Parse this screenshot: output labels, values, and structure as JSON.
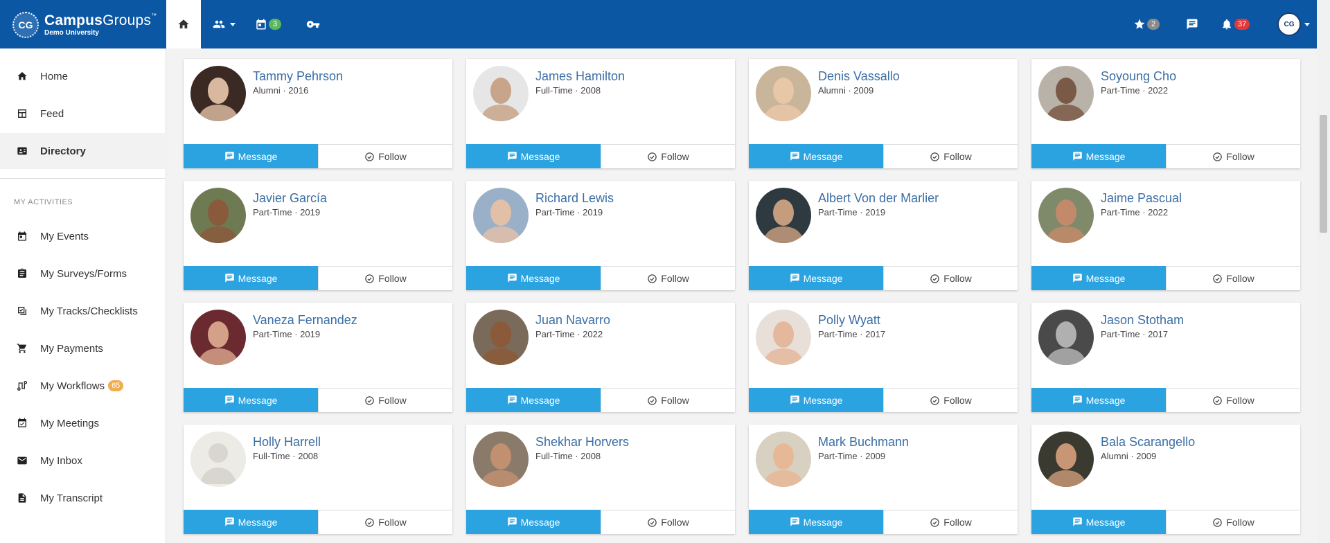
{
  "header": {
    "brand_main": "Campus",
    "brand_light": "Groups",
    "brand_tm": "™",
    "brand_sub": "Demo University",
    "logo_initials": "CG",
    "events_badge": "3",
    "favorites_badge": "2",
    "notifications_badge": "37",
    "colors": {
      "bar": "#0b57a4",
      "green": "#5cb85c",
      "red": "#e2393b"
    }
  },
  "sidebar": {
    "home": "Home",
    "feed": "Feed",
    "directory": "Directory",
    "heading": "MY ACTIVITIES",
    "my_events": "My Events",
    "my_surveys": "My Surveys/Forms",
    "my_tracks": "My Tracks/Checklists",
    "my_payments": "My Payments",
    "my_workflows": "My Workflows",
    "workflows_badge": "65",
    "my_meetings": "My Meetings",
    "my_inbox": "My Inbox",
    "my_transcript": "My Transcript"
  },
  "buttons": {
    "message": "Message",
    "follow": "Follow"
  },
  "people": [
    {
      "name": "Tammy Pehrson",
      "meta": "Alumni · 2016"
    },
    {
      "name": "James Hamilton",
      "meta": "Full-Time · 2008"
    },
    {
      "name": "Denis Vassallo",
      "meta": "Alumni · 2009"
    },
    {
      "name": "Soyoung Cho",
      "meta": "Part-Time · 2022"
    },
    {
      "name": "Javier García",
      "meta": "Part-Time · 2019"
    },
    {
      "name": "Richard Lewis",
      "meta": "Part-Time · 2019"
    },
    {
      "name": "Albert Von der Marlier",
      "meta": "Part-Time · 2019"
    },
    {
      "name": "Jaime Pascual",
      "meta": "Part-Time · 2022"
    },
    {
      "name": "Vaneza Fernandez",
      "meta": "Part-Time · 2019"
    },
    {
      "name": "Juan Navarro",
      "meta": "Part-Time · 2022"
    },
    {
      "name": "Polly Wyatt",
      "meta": "Part-Time · 2017"
    },
    {
      "name": "Jason Stotham",
      "meta": "Part-Time · 2017"
    },
    {
      "name": "Holly Harrell",
      "meta": "Full-Time · 2008"
    },
    {
      "name": "Shekhar Horvers",
      "meta": "Full-Time · 2008"
    },
    {
      "name": "Mark Buchmann",
      "meta": "Part-Time · 2009"
    },
    {
      "name": "Bala Scarangello",
      "meta": "Alumni · 2009"
    }
  ]
}
